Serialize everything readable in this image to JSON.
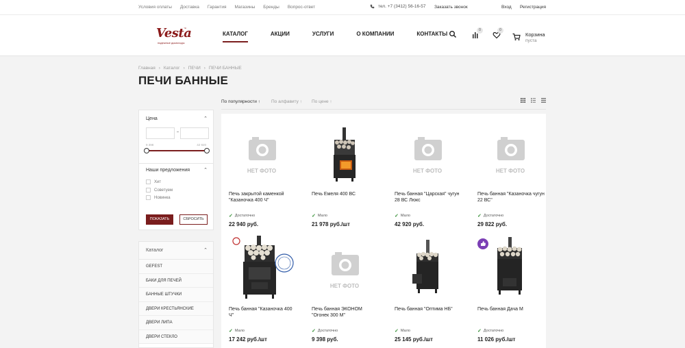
{
  "topbar": {
    "links": [
      "Условия оплаты",
      "Доставка",
      "Гарантия",
      "Магазины",
      "Бренды",
      "Вопрос-ответ"
    ],
    "phone": "тел. +7 (3412) 56-16-57",
    "callback": "Заказать звонок",
    "login": "Вход",
    "register": "Регистрация"
  },
  "header": {
    "logo_word": "Vesta",
    "logo_tm": "™",
    "logo_tagline": "надежные дымоходы",
    "nav": [
      "КАТАЛОГ",
      "АКЦИИ",
      "УСЛУГИ",
      "О КОМПАНИИ",
      "КОНТАКТЫ"
    ],
    "compare_count": "0",
    "favorites_count": "0",
    "cart_label": "Корзина",
    "cart_status": "пуста"
  },
  "breadcrumb": [
    "Главная",
    "Каталог",
    "ПЕЧИ",
    "ПЕЧИ БАННЫЕ"
  ],
  "page_title": "ПЕЧИ БАННЫЕ",
  "sort": {
    "popularity": "По популярности",
    "alphabet": "По алфавиту",
    "price": "По цене"
  },
  "filter": {
    "price_title": "Цена",
    "price_min": "9 398",
    "price_max": "42 920",
    "offers_title": "Наши предложения",
    "offers": [
      "Хит",
      "Советуем",
      "Новинка"
    ],
    "show_button": "ПОКАЗАТЬ",
    "reset_button": "СБРОСИТЬ"
  },
  "catalog_menu": {
    "title": "Каталог",
    "items": [
      "GEFEST",
      "БАКИ ДЛЯ ПЕЧЕЙ",
      "БАННЫЕ ШТУЧКИ",
      "ДВЕРИ КРЕСТЬЯНСКИЕ",
      "ДВЕРИ ЛИПА",
      "ДВЕРИ СТЕКЛО"
    ]
  },
  "no_photo_label": "НЕТ ФОТО",
  "products": [
    {
      "name": "Печь закрытой каменкой \"Казаночка 400 Ч\"",
      "stock": "Достаточно",
      "price": "22 940 руб."
    },
    {
      "name": "Печь Емеля 400 ВС",
      "stock": "Мало",
      "price": "21 978 руб./шт"
    },
    {
      "name": "Печь банная \"Царская\" чугун 28 ВС Люкс",
      "stock": "Мало",
      "price": "42 920 руб."
    },
    {
      "name": "Печь банная \"Казаночка чугун 22 ВС\"",
      "stock": "Достаточно",
      "price": "29 822 руб."
    },
    {
      "name": "Печь банная \"Казаночка 400 Ч\"",
      "stock": "Мало",
      "price": "17 242 руб./шт"
    },
    {
      "name": "Печь банная ЭКОНОМ \"Огонек 300 М\"",
      "stock": "Достаточно",
      "price": "9 398 руб."
    },
    {
      "name": "Печь банная \"Оптима НБ\"",
      "stock": "Мало",
      "price": "25 145 руб./шт"
    },
    {
      "name": "Печь банная Дача М",
      "stock": "Достаточно",
      "price": "11 026 руб./шт"
    }
  ],
  "colors": {
    "accent": "#7a1d1d",
    "stock_check": "#2e8b2e",
    "hit_badge": "#7b3fb5"
  }
}
